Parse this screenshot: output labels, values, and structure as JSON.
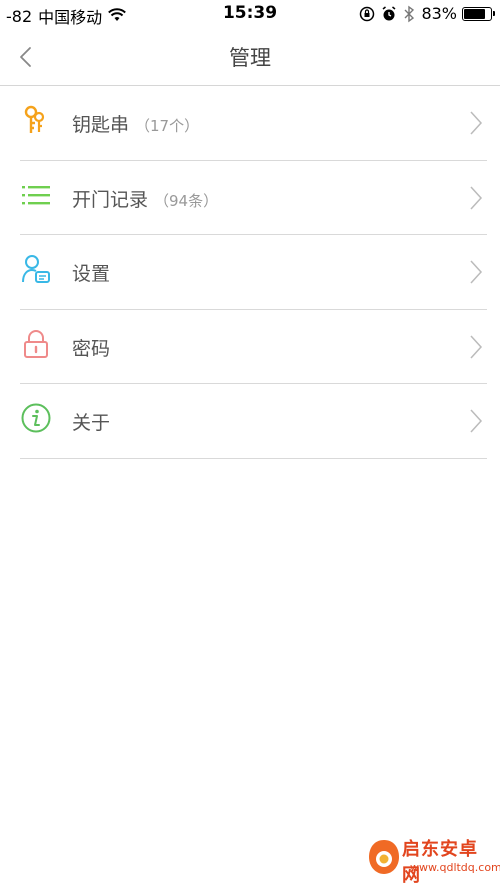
{
  "status_bar": {
    "signal": "-82",
    "carrier": "中国移动",
    "time": "15:39",
    "battery_percent": "83%",
    "battery_level": 0.83,
    "icons": [
      "wifi-icon",
      "orientation-lock-icon",
      "alarm-icon",
      "bluetooth-icon",
      "battery-icon"
    ]
  },
  "nav": {
    "title": "管理",
    "back_icon": "chevron-left-icon"
  },
  "menu": {
    "items": [
      {
        "label": "钥匙串",
        "count": "（17个）",
        "icon": "keys-icon",
        "color": "#f5a21b"
      },
      {
        "label": "开门记录",
        "count": "（94条）",
        "icon": "list-icon",
        "color": "#6fcf4f"
      },
      {
        "label": "设置",
        "count": "",
        "icon": "user-settings-icon",
        "color": "#39b8e6"
      },
      {
        "label": "密码",
        "count": "",
        "icon": "lock-icon",
        "color": "#ef8a8a"
      },
      {
        "label": "关于",
        "count": "",
        "icon": "info-icon",
        "color": "#5cbf5c"
      }
    ]
  },
  "watermark": {
    "name": "启东安卓网",
    "url": "www.qdltdq.com"
  }
}
